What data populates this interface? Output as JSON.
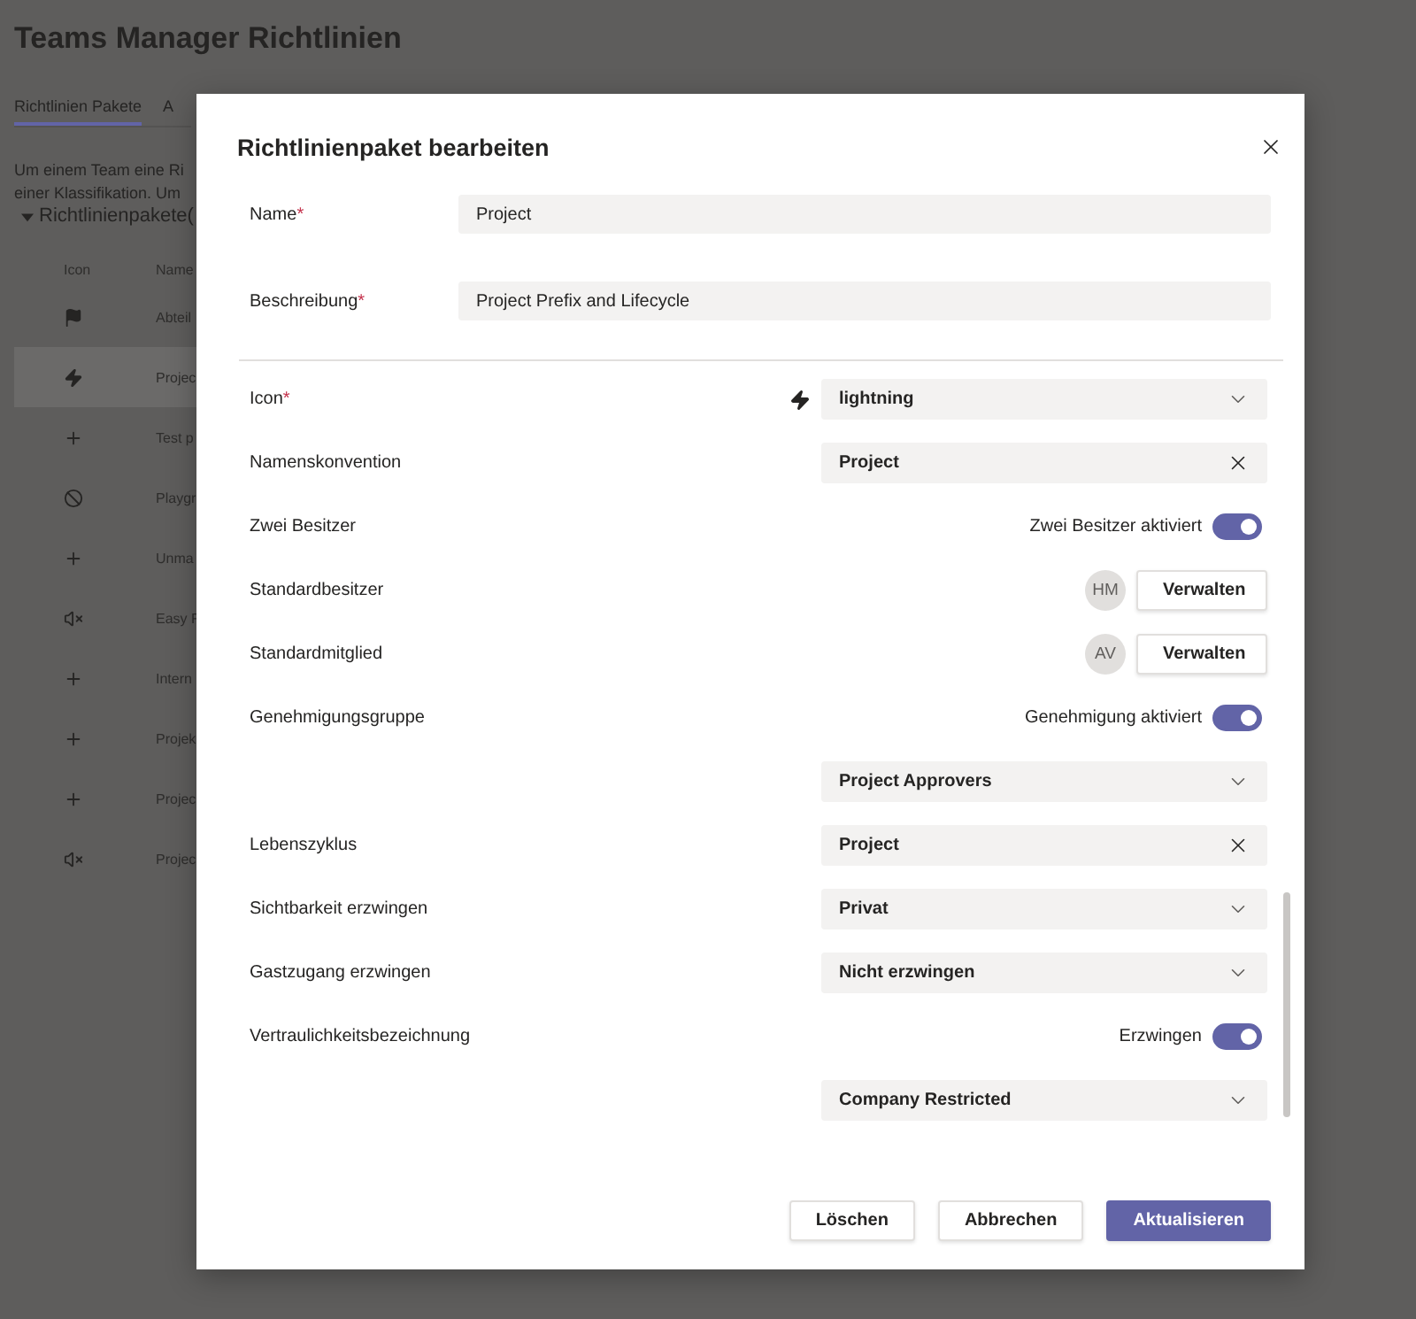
{
  "page": {
    "title": "Teams Manager Richtlinien",
    "tabs": [
      {
        "label": "Richtlinien Pakete",
        "selected": true
      },
      {
        "label": "A",
        "selected": false
      }
    ],
    "intro_lines": [
      "Um einem Team eine Ri",
      "einer Klassifikation. Um"
    ],
    "section": {
      "label": "Richtlinienpakete(",
      "expanded": true
    },
    "table": {
      "columns": [
        "Icon",
        "Name"
      ],
      "rows": [
        {
          "kind": "flag",
          "name": "Abteil",
          "selected": false
        },
        {
          "kind": "lightning",
          "name": "Projec",
          "selected": true
        },
        {
          "kind": "plus",
          "name": "Test p",
          "selected": false
        },
        {
          "kind": "blocked",
          "name": "Playgr",
          "selected": false
        },
        {
          "kind": "plus",
          "name": "Unma",
          "selected": false
        },
        {
          "kind": "muted",
          "name": "Easy F",
          "selected": false
        },
        {
          "kind": "plus",
          "name": "Intern",
          "selected": false
        },
        {
          "kind": "plus",
          "name": "Projek",
          "selected": false
        },
        {
          "kind": "plus",
          "name": "Projec",
          "selected": false
        },
        {
          "kind": "muted",
          "name": "Projec",
          "selected": false
        }
      ]
    }
  },
  "dialog": {
    "title": "Richtlinienpaket bearbeiten",
    "fields": [
      {
        "label": "Name",
        "required_mark": "*",
        "value": "Project"
      },
      {
        "label": "Beschreibung",
        "required_mark": "*",
        "value": "Project Prefix and Lifecycle"
      }
    ],
    "settings": [
      {
        "kind": "dropdown",
        "label": "Icon",
        "required_mark": "*",
        "has_icon": true,
        "value": "lightning"
      },
      {
        "kind": "clearable",
        "label": "Namenskonvention",
        "value": "Project"
      },
      {
        "kind": "toggle",
        "label": "Zwei Besitzer",
        "toggle_label": "Zwei Besitzer aktiviert",
        "on": true
      },
      {
        "kind": "people",
        "label": "Standardbesitzer",
        "initials": "HM",
        "button": "Verwalten"
      },
      {
        "kind": "people",
        "label": "Standardmitglied",
        "initials": "AV",
        "button": "Verwalten"
      },
      {
        "kind": "toggle",
        "label": "Genehmigungsgruppe",
        "toggle_label": "Genehmigung aktiviert",
        "on": true
      },
      {
        "kind": "dropdown",
        "value": "Project Approvers"
      },
      {
        "kind": "clearable",
        "label": "Lebenszyklus",
        "value": "Project"
      },
      {
        "kind": "dropdown",
        "label": "Sichtbarkeit erzwingen",
        "value": "Privat"
      },
      {
        "kind": "dropdown",
        "label": "Gastzugang erzwingen",
        "value": "Nicht erzwingen"
      },
      {
        "kind": "toggle",
        "label": "Vertraulichkeitsbezeichnung",
        "toggle_label": "Erzwingen",
        "on": true
      },
      {
        "kind": "dropdown",
        "value": "Company Restricted"
      }
    ],
    "buttons": [
      {
        "label": "Löschen",
        "primary": false
      },
      {
        "label": "Abbrechen",
        "primary": false
      },
      {
        "label": "Aktualisieren",
        "primary": true
      }
    ]
  }
}
